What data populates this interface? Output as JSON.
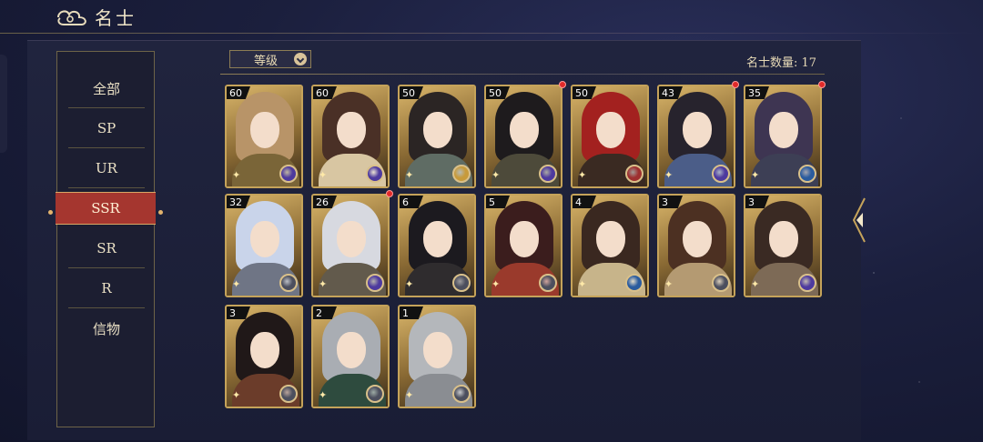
{
  "header": {
    "title": "名士"
  },
  "sidebar": {
    "items": [
      {
        "label": "全部"
      },
      {
        "label": "SP"
      },
      {
        "label": "UR"
      },
      {
        "label": "SSR"
      },
      {
        "label": "SR"
      },
      {
        "label": "R"
      },
      {
        "label": "信物"
      }
    ],
    "selected": "SSR"
  },
  "toolbar": {
    "sort_label": "等级",
    "count_label": "名士数量: 17"
  },
  "colors": {
    "accent_gold": "#c5a35a",
    "selected_tab": "#a5362f",
    "notify_red": "#e02a2a"
  },
  "cards": [
    {
      "level": "60",
      "notify": false,
      "element": "purple",
      "hair": "#b89468",
      "robe": "#7a6538"
    },
    {
      "level": "60",
      "notify": false,
      "element": "purple",
      "hair": "#4a3026",
      "robe": "#d8c6a2"
    },
    {
      "level": "50",
      "notify": false,
      "element": "gold",
      "hair": "#2b2524",
      "robe": "#5f6c64"
    },
    {
      "level": "50",
      "notify": true,
      "element": "purple",
      "hair": "#1e1b1d",
      "robe": "#4d4a3a"
    },
    {
      "level": "50",
      "notify": false,
      "element": "red",
      "hair": "#a3211f",
      "robe": "#3a2a22"
    },
    {
      "level": "43",
      "notify": true,
      "element": "purple",
      "hair": "#27232d",
      "robe": "#4b5d88"
    },
    {
      "level": "35",
      "notify": true,
      "element": "blue",
      "hair": "#3e3552",
      "robe": "#3d3f55"
    },
    {
      "level": "32",
      "notify": false,
      "element": "gray",
      "hair": "#c9d4ea",
      "robe": "#6f7585"
    },
    {
      "level": "26",
      "notify": true,
      "element": "purple",
      "hair": "#d7d9e0",
      "robe": "#625a4c"
    },
    {
      "level": "6",
      "notify": false,
      "element": "gray",
      "hair": "#1c1a1f",
      "robe": "#2f2c2e"
    },
    {
      "level": "5",
      "notify": false,
      "element": "gray",
      "hair": "#3b1d1d",
      "robe": "#9a3a2c"
    },
    {
      "level": "4",
      "notify": false,
      "element": "blue",
      "hair": "#3a2820",
      "robe": "#c7b48a"
    },
    {
      "level": "3",
      "notify": false,
      "element": "gray",
      "hair": "#4c3022",
      "robe": "#b49a72"
    },
    {
      "level": "3",
      "notify": false,
      "element": "purple",
      "hair": "#3a2a23",
      "robe": "#7d6a56"
    },
    {
      "level": "3",
      "notify": false,
      "element": "gray",
      "hair": "#201818",
      "robe": "#6b3c2a"
    },
    {
      "level": "2",
      "notify": false,
      "element": "gray",
      "hair": "#a9adb3",
      "robe": "#2e4b3e"
    },
    {
      "level": "1",
      "notify": false,
      "element": "gray",
      "hair": "#b4b7bb",
      "robe": "#8a8d92"
    }
  ]
}
